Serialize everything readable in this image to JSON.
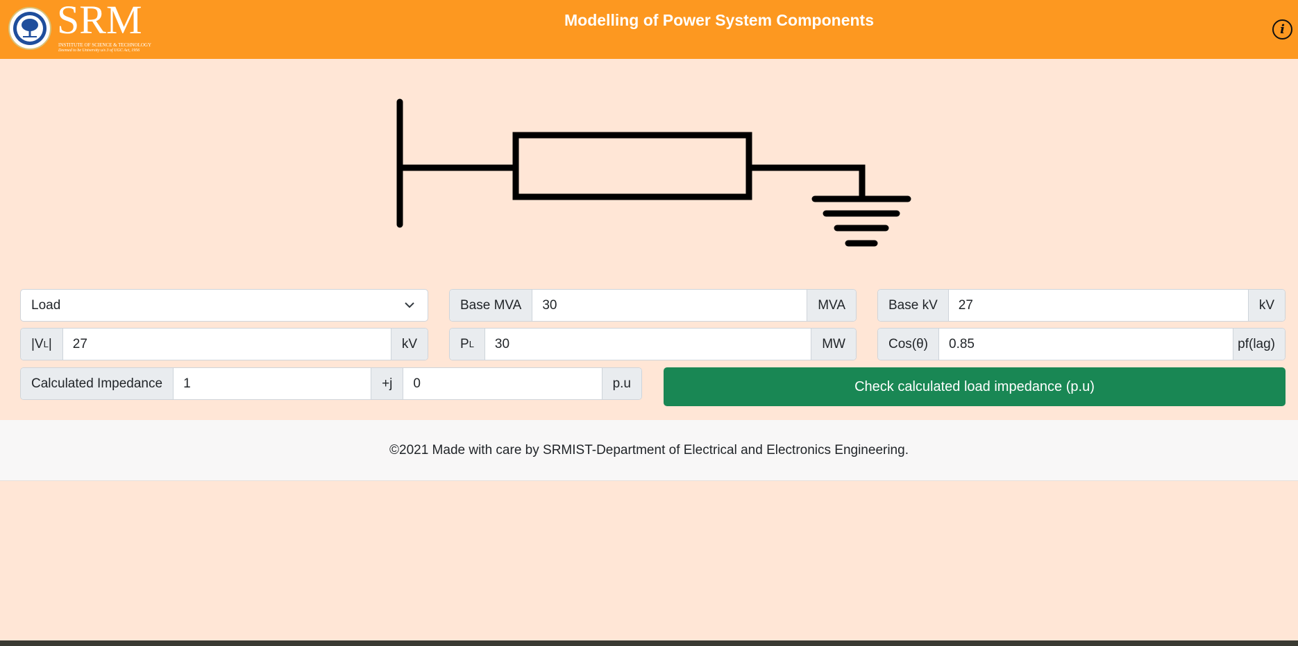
{
  "header": {
    "title": "Modelling of Power System Components",
    "logo": {
      "wordmark": "SRM",
      "line1": "INSTITUTE OF SCIENCE & TECHNOLOGY",
      "line2": "Deemed to be University u/s 3 of UGC Act, 1956"
    },
    "info_icon": "i"
  },
  "colors": {
    "header_bg": "#fd9820",
    "page_bg": "#ffe6d6",
    "button_bg": "#198754",
    "footer_bg": "#f8f7f7"
  },
  "form": {
    "component_select": {
      "value": "Load"
    },
    "base_mva": {
      "label": "Base MVA",
      "value": "30",
      "unit": "MVA"
    },
    "base_kv": {
      "label": "Base kV",
      "value": "27",
      "unit": "kV"
    },
    "vl": {
      "label_pre": "|V",
      "label_sub": "L",
      "label_post": "|",
      "value": "27",
      "unit": "kV"
    },
    "pl": {
      "label_pre": "P",
      "label_sub": "L",
      "value": "30",
      "unit": "MW"
    },
    "cos": {
      "label": "Cos(θ)",
      "value": "0.85",
      "unit": "pf(lag)"
    },
    "impedance": {
      "label": "Calculated Impedance",
      "real": "1",
      "join": "+j",
      "imag": "0",
      "unit": "p.u"
    }
  },
  "check_button": {
    "label": "Check calculated load impedance (p.u)"
  },
  "footer": {
    "text": "©2021 Made with care by SRMIST-Department of Electrical and Electronics Engineering."
  }
}
